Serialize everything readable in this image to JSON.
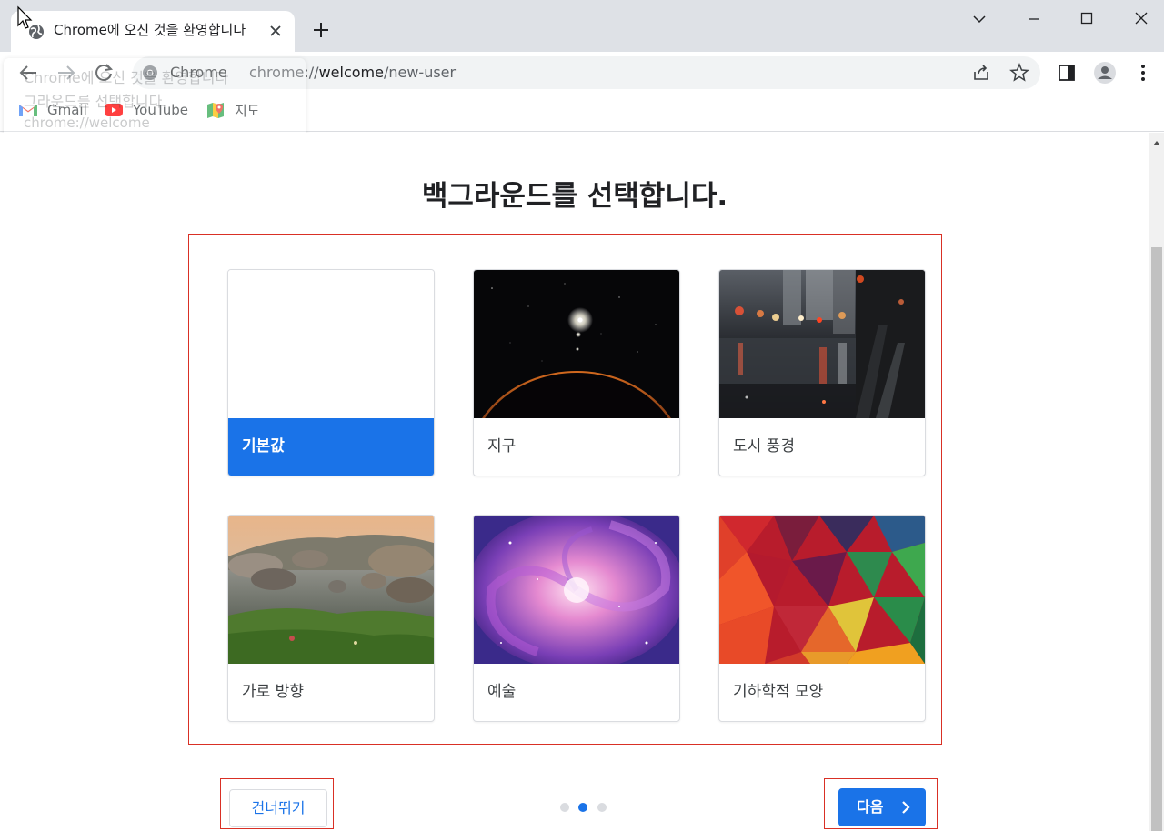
{
  "browser": {
    "tab_title": "Chrome에 오신 것을 환영합니다",
    "omnibox": {
      "chip": "Chrome",
      "url_scheme": "chrome://",
      "url_host": "welcome",
      "url_path": "/new-user"
    },
    "bookmarks": [
      {
        "label": "Gmail",
        "icon": "gmail-icon"
      },
      {
        "label": "YouTube",
        "icon": "youtube-icon"
      },
      {
        "label": "지도",
        "icon": "maps-icon"
      }
    ],
    "ghost_tooltip": {
      "line1": "Chrome에 오신 것을 환영합니다",
      "line2": "그라운드를 선택합니다.",
      "line3": "chrome://welcome"
    }
  },
  "page": {
    "heading": "백그라운드를 선택합니다.",
    "backgrounds": [
      {
        "label": "기본값",
        "selected": true,
        "image": "blank"
      },
      {
        "label": "지구",
        "selected": false,
        "image": "earth-space"
      },
      {
        "label": "도시 풍경",
        "selected": false,
        "image": "city-street-night"
      },
      {
        "label": "가로 방향",
        "selected": false,
        "image": "rocky-coast-landscape"
      },
      {
        "label": "예술",
        "selected": false,
        "image": "purple-galaxy"
      },
      {
        "label": "기하학적 모양",
        "selected": false,
        "image": "colorful-polygons"
      }
    ],
    "skip_label": "건너뛰기",
    "next_label": "다음",
    "pager": {
      "pages": 3,
      "current": 2
    }
  },
  "colors": {
    "accent": "#1a73e8",
    "highlight": "#d93025"
  }
}
